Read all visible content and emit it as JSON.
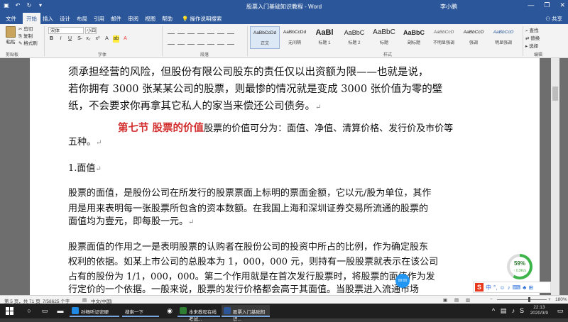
{
  "titlebar": {
    "doc_title": "股票入门基础知识教程 - Word",
    "user": "李小鹏",
    "minimize": "—",
    "restore": "❐",
    "close": "✕"
  },
  "tabs": [
    "文件",
    "开始",
    "插入",
    "设计",
    "布局",
    "引用",
    "邮件",
    "审阅",
    "视图",
    "帮助"
  ],
  "active_tab": "开始",
  "tell_me": "操作说明搜索",
  "share": "共享",
  "ribbon": {
    "clipboard": {
      "paste": "粘贴",
      "cut": "剪切",
      "copy": "复制",
      "format_painter": "格式刷",
      "label": "剪贴板"
    },
    "font": {
      "name": "宋体",
      "size": "小四",
      "bold": "B",
      "italic": "I",
      "underline": "U",
      "label": "字体"
    },
    "paragraph": {
      "label": "段落"
    },
    "styles": {
      "items": [
        {
          "preview": "AaBbCcDd",
          "name": "正文"
        },
        {
          "preview": "AaBbCcDd",
          "name": "无间隔"
        },
        {
          "preview": "AaBl",
          "name": "标题 1"
        },
        {
          "preview": "AaBbC",
          "name": "标题 2"
        },
        {
          "preview": "AaBbC",
          "name": "标题"
        },
        {
          "preview": "AaBbC",
          "name": "副标题"
        },
        {
          "preview": "AaBbCcD",
          "name": "不明显强调"
        },
        {
          "preview": "AaBbCcD",
          "name": "强调"
        },
        {
          "preview": "AaBbCcD",
          "name": "明显强调"
        }
      ],
      "label": "样式"
    },
    "editing": {
      "find": "查找",
      "replace": "替换",
      "select": "选择",
      "label": "编辑"
    }
  },
  "document": {
    "lines": [
      "须承担经营的风险，但股份有限公司股东的责任仅以出资额为限——也就是说，",
      "若你拥有 3000 张某某公司的股票，则最惨的情况就是变成 3000 张价值为零的壁",
      "纸，不会要求你再拿其它私人的家当来偿还公司债务。"
    ],
    "section_heading": "第七节  股票的价值",
    "section_text_1": "股票的价值可分为：面值、净值、清算价格、发行价及市价等",
    "section_text_2": "五种。",
    "subheading": "1.面值",
    "para1": [
      "股票的面值，是股份公司在所发行的股票票面上标明的票面金额，它以元/股为单位，其作",
      "用是用来表明每一张股票所包含的资本数额。在我国上海和深圳证券交易所流通的股票的",
      "面值均为壹元，即每股一元。"
    ],
    "para2": [
      "股票面值的作用之一是表明股票的认购者在股份公司的投资中所占的比例，作为确定股东",
      "权利的依据。如某上市公司的总股本为 1，000，000 元，则持有一股股票就表示在该公司",
      "占有的股份为 1/1，000，000。第二个作用就是在首次发行股票时，将股票的面值作为发",
      "行定价的一个依据。一般来说，股票的发行价格都会高于其面值。当股票进入流通市场"
    ],
    "return_mark": "↵"
  },
  "widgets": {
    "progress_percent": 59,
    "progress_label": "59%",
    "progress_sub": "↑ 0.9K/s",
    "cursor_dot": "00:00"
  },
  "statusbar": {
    "page": "第 5 页，共 71 页",
    "words": "7/58625 个字",
    "lang": "中文(中国)",
    "zoom": "180%"
  },
  "taskbar": {
    "apps": [
      {
        "label": "孙畅听证密硬",
        "color": "#1e88e5"
      },
      {
        "label": "搜索一下",
        "color": "#2f6bd6"
      },
      {
        "label": "本来教程在线考试...",
        "color": "#2e7d32"
      },
      {
        "label": "股票入门基础知识...",
        "color": "#2b579a"
      }
    ],
    "time": "22:13",
    "date": "2020/3/9"
  }
}
